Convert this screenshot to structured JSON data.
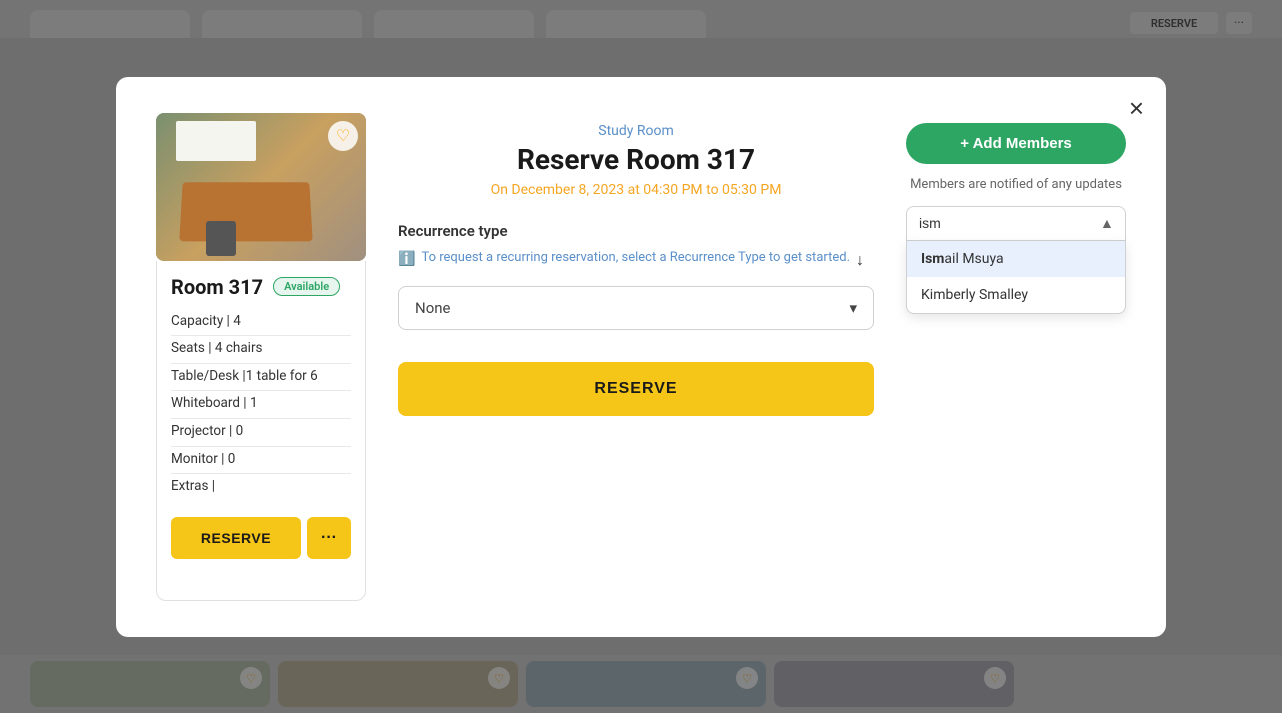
{
  "background": {
    "top_cards": [
      "card1",
      "card2",
      "card3",
      "card4"
    ],
    "reserve_label": "RESERVE",
    "dots_label": "···"
  },
  "modal": {
    "close_label": "×",
    "room_card": {
      "title": "Room 317",
      "available_label": "Available",
      "capacity": "Capacity | 4",
      "seats": "Seats | 4 chairs",
      "table": "Table/Desk |1 table for 6",
      "whiteboard": "Whiteboard | 1",
      "projector": "Projector | 0",
      "monitor": "Monitor | 0",
      "extras": "Extras |",
      "reserve_btn": "RESERVE",
      "dots_btn": "···"
    },
    "main": {
      "category": "Study Room",
      "title": "Reserve Room 317",
      "date": "On December 8, 2023 at 04:30 PM to 05:30 PM",
      "recurrence_label": "Recurrence type",
      "info_text": "To request a recurring reservation, select a Recurrence Type to get started.",
      "recurrence_value": "None",
      "reserve_btn": "RESERVE"
    },
    "right": {
      "add_members_label": "+ Add Members",
      "members_note": "Members are notified of any updates",
      "search_value": "ism",
      "dropdown_items": [
        {
          "name": "Ismail Msuya",
          "highlighted": true,
          "bold_part": "Ism"
        },
        {
          "name": "Kimberly Smalley",
          "highlighted": false,
          "bold_part": ""
        }
      ]
    }
  },
  "bottom_cards": [
    {
      "heart": "♡"
    },
    {
      "heart": "♡"
    },
    {
      "heart": "♡"
    },
    {
      "heart": "♡"
    }
  ]
}
